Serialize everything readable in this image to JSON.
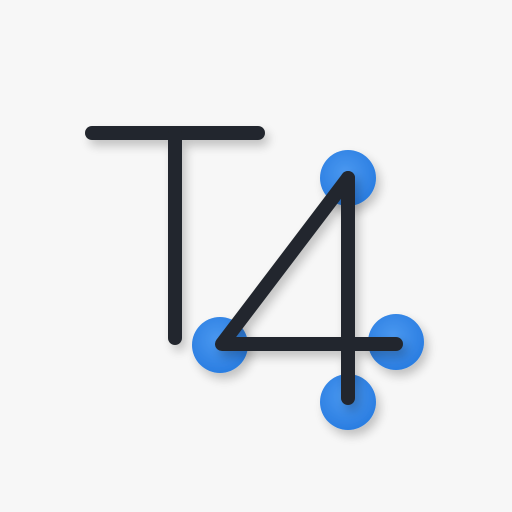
{
  "logo": {
    "stroke_color": "#23282d",
    "node_color": "#2a7de1",
    "node_highlight": "#4a98f0",
    "background_color": "#f7f7f7",
    "node_count": 4
  }
}
